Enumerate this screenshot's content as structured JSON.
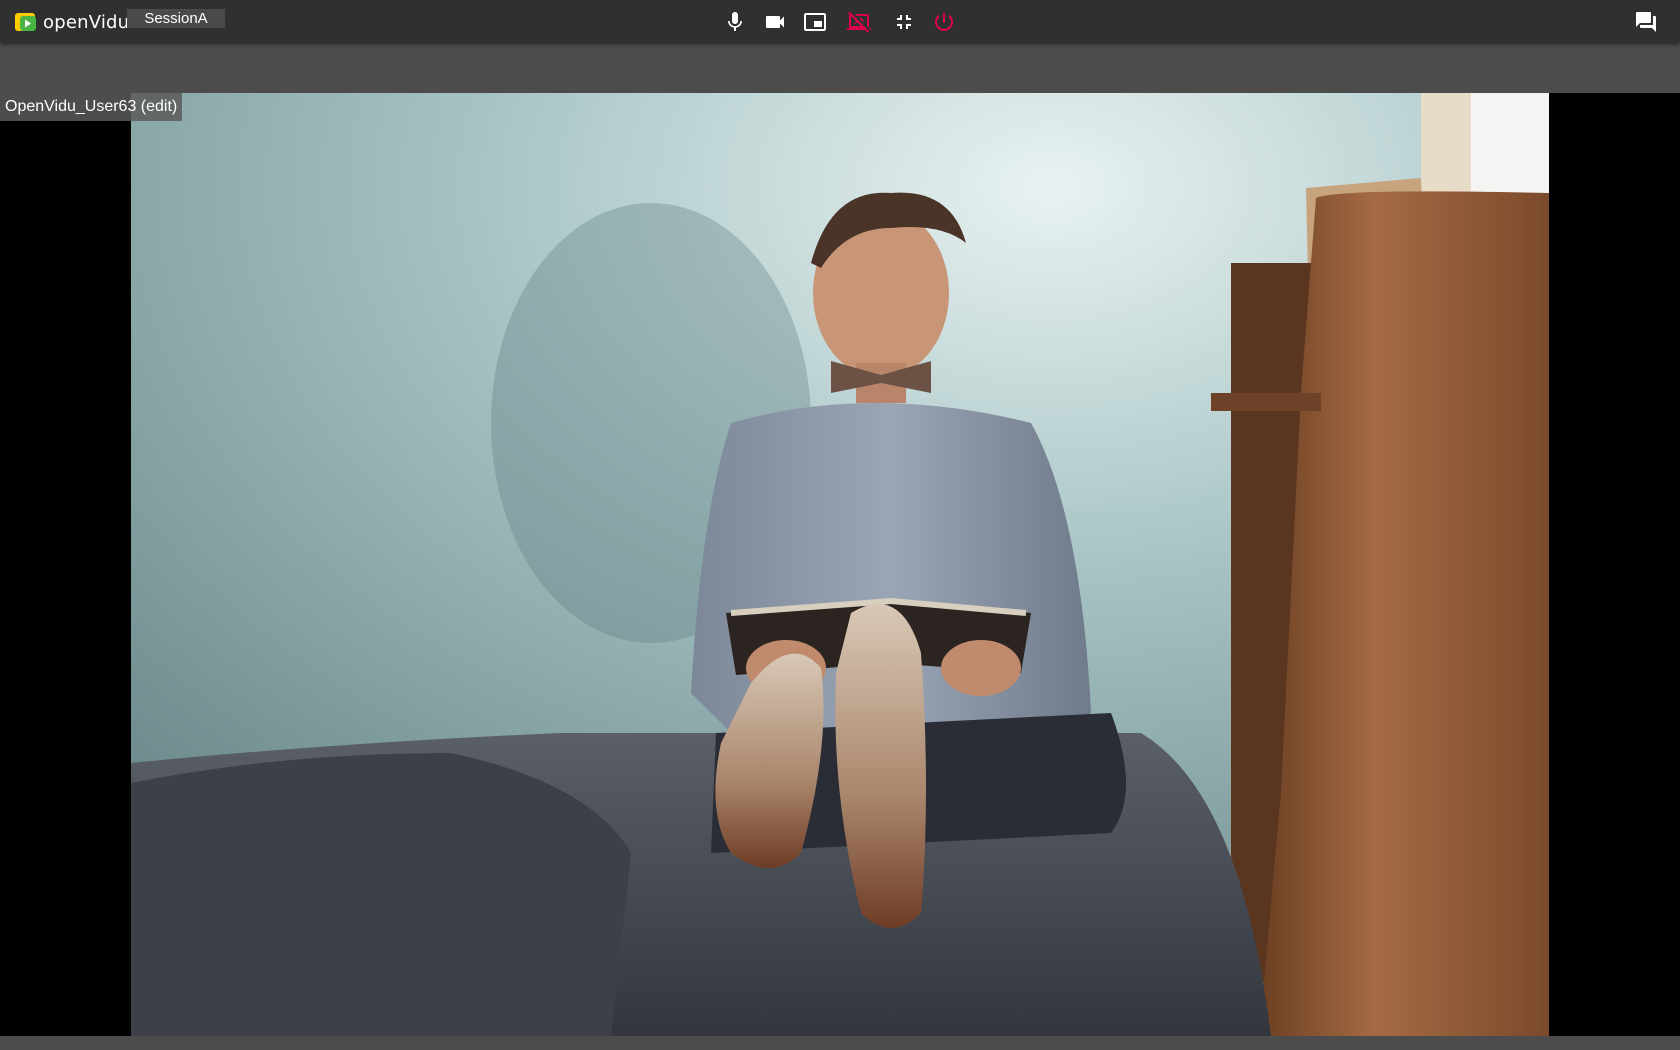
{
  "app": {
    "logo_text": "openVidu",
    "session_name": "SessionA"
  },
  "toolbar": {
    "buttons": [
      {
        "name": "mic-button",
        "icon": "microphone-icon",
        "color": "#ffffff"
      },
      {
        "name": "camera-button",
        "icon": "videocam-icon",
        "color": "#ffffff"
      },
      {
        "name": "screen-share-button",
        "icon": "picture-in-picture-icon",
        "color": "#ffffff"
      },
      {
        "name": "stop-screen-share-button",
        "icon": "screen-share-off-icon",
        "color": "#e0004d"
      },
      {
        "name": "exit-fullscreen-button",
        "icon": "fullscreen-exit-icon",
        "color": "#ffffff"
      },
      {
        "name": "leave-session-button",
        "icon": "power-icon",
        "color": "#e0004d"
      },
      {
        "name": "chat-button",
        "icon": "chat-icon",
        "color": "#ffffff"
      }
    ]
  },
  "video": {
    "participant_nickname": "OpenVidu_User63 (edit)"
  },
  "colors": {
    "toolbar_bg": "#303030",
    "strip_bg": "#4c4c4c",
    "accent_red": "#e0004d",
    "logo_yellow": "#ffcc00",
    "logo_green": "#4bb543"
  }
}
